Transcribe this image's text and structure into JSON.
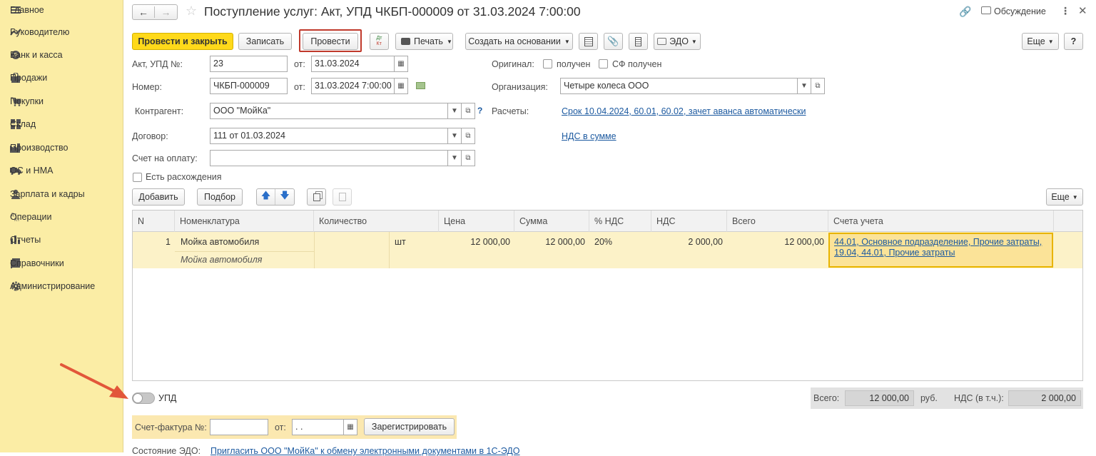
{
  "sidebar": {
    "items": [
      {
        "label": "Главное",
        "icon": "menu-icon"
      },
      {
        "label": "Руководителю",
        "icon": "trend-icon"
      },
      {
        "label": "Банк и касса",
        "icon": "coin-icon"
      },
      {
        "label": "Продажи",
        "icon": "bag-icon"
      },
      {
        "label": "Покупки",
        "icon": "cart-icon"
      },
      {
        "label": "Склад",
        "icon": "grid-icon"
      },
      {
        "label": "Производство",
        "icon": "factory-icon"
      },
      {
        "label": "ОС и НМА",
        "icon": "truck-icon"
      },
      {
        "label": "Зарплата и кадры",
        "icon": "person-icon"
      },
      {
        "label": "Операции",
        "icon": "dt-kt-icon"
      },
      {
        "label": "Отчеты",
        "icon": "bar-chart-icon"
      },
      {
        "label": "Справочники",
        "icon": "book-icon"
      },
      {
        "label": "Администрирование",
        "icon": "gear-icon"
      }
    ]
  },
  "header": {
    "title": "Поступление услуг: Акт, УПД ЧКБП-000009 от 31.03.2024 7:00:00",
    "discussion": "Обсуждение"
  },
  "toolbar": {
    "post_close": "Провести и закрыть",
    "save": "Записать",
    "post": "Провести",
    "dt_kt": "Дт Кт",
    "print": "Печать",
    "create_based": "Создать на основании",
    "edo": "ЭДО",
    "more": "Еще",
    "help": "?"
  },
  "form": {
    "act_label": "Акт, УПД №:",
    "act_value": "23",
    "from_label": "от:",
    "act_date": "31.03.2024",
    "number_label": "Номер:",
    "number_value": "ЧКБП-000009",
    "number_date": "31.03.2024  7:00:00",
    "original_label": "Оригинал:",
    "received_label": "получен",
    "sf_received_label": "СФ получен",
    "org_label": "Организация:",
    "org_value": "Четыре колеса ООО",
    "counterparty_label": "Контрагент:",
    "counterparty_value": "ООО \"МойКа\"",
    "settlements_label": "Расчеты:",
    "settlements_link": "Срок 10.04.2024, 60.01, 60.02, зачет аванса автоматически",
    "vat_link": "НДС в сумме",
    "contract_label": "Договор:",
    "contract_value": "111 от 01.03.2024",
    "invoice_label": "Счет на оплату:",
    "invoice_value": "",
    "discrepancy_label": "Есть расхождения"
  },
  "table_toolbar": {
    "add": "Добавить",
    "pick": "Подбор",
    "more": "Еще"
  },
  "table": {
    "columns": [
      "N",
      "Номенклатура",
      "Количество",
      "Цена",
      "Сумма",
      "% НДС",
      "НДС",
      "Всего",
      "Счета учета"
    ],
    "rows": [
      {
        "n": "1",
        "item": "Мойка автомобиля",
        "item_content": "Мойка автомобиля",
        "qty": "",
        "unit": "шт",
        "price": "12 000,00",
        "sum": "12 000,00",
        "vat_rate": "20%",
        "vat": "2 000,00",
        "total": "12 000,00",
        "accounts": "44.01, Основное подразделение, Прочие затраты,",
        "accounts2": "19.04, 44.01, Прочие затраты"
      }
    ]
  },
  "footer": {
    "upd_label": "УПД",
    "upd_on": false,
    "total_label": "Всего:",
    "total_value": "12 000,00",
    "currency": "руб.",
    "vat_label": "НДС (в т.ч.):",
    "vat_value": "2 000,00",
    "sf_label": "Счет-фактура №:",
    "sf_number": "",
    "sf_from_label": "от:",
    "sf_date": " .  .",
    "register_btn": "Зарегистрировать",
    "edo_state_label": "Состояние ЭДО:",
    "edo_state_link": "Пригласить ООО \"МойКа\" к обмену электронными документами в 1С-ЭДО"
  },
  "colors": {
    "sidebar_bg": "#fbeda5",
    "primary_button": "#ffd91a",
    "highlight_border": "#c0392b",
    "arrow": "#e2573a",
    "link": "#1d5aa0"
  }
}
